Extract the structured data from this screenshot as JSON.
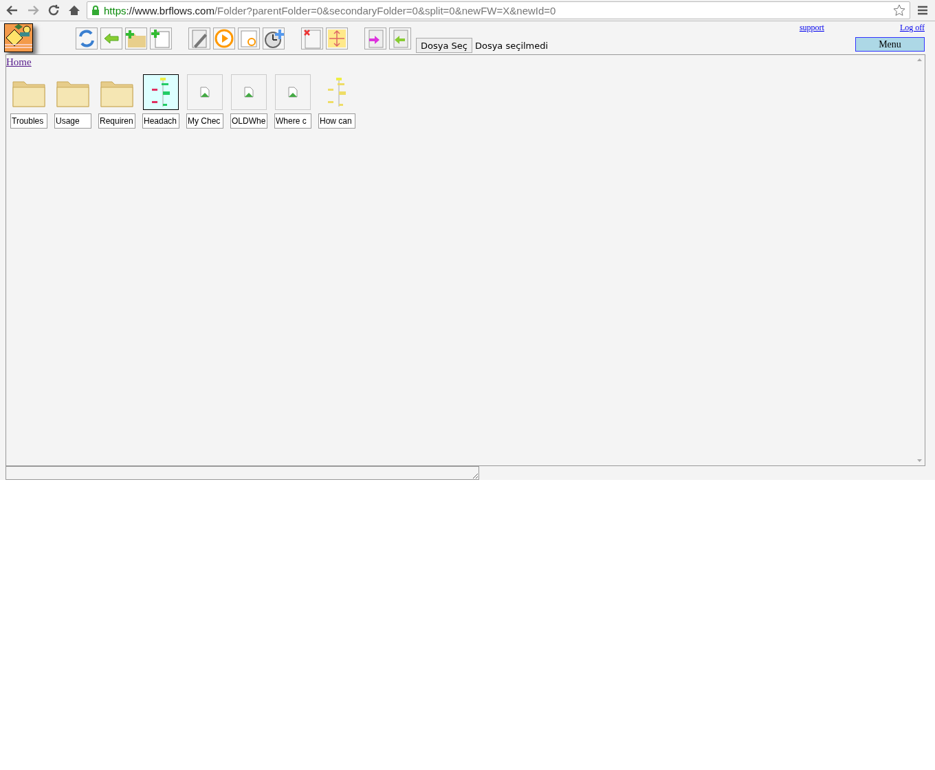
{
  "browser": {
    "url": {
      "scheme": "https",
      "host": "://www.brflows.com",
      "path": "/Folder?parentFolder=0&secondaryFolder=0&split=0&newFW=X&newId=0"
    }
  },
  "header": {
    "file_button": "Dosya Seç",
    "file_status": "Dosya seçilmedi",
    "support_link": "support",
    "logoff_link": "Log off",
    "menu_button": "Menu"
  },
  "breadcrumb": "Home",
  "items": [
    {
      "kind": "folder",
      "label": "Troubles",
      "selected": false
    },
    {
      "kind": "folder",
      "label": "Usage",
      "selected": false
    },
    {
      "kind": "folder",
      "label": "Requiren",
      "selected": false
    },
    {
      "kind": "flowchart",
      "label": "Headach",
      "selected": true
    },
    {
      "kind": "broken",
      "label": "My Chec",
      "selected": false
    },
    {
      "kind": "broken",
      "label": "OLDWhe",
      "selected": false
    },
    {
      "kind": "broken",
      "label": "Where c",
      "selected": false
    },
    {
      "kind": "flowchart-light",
      "label": "How can",
      "selected": false
    }
  ]
}
